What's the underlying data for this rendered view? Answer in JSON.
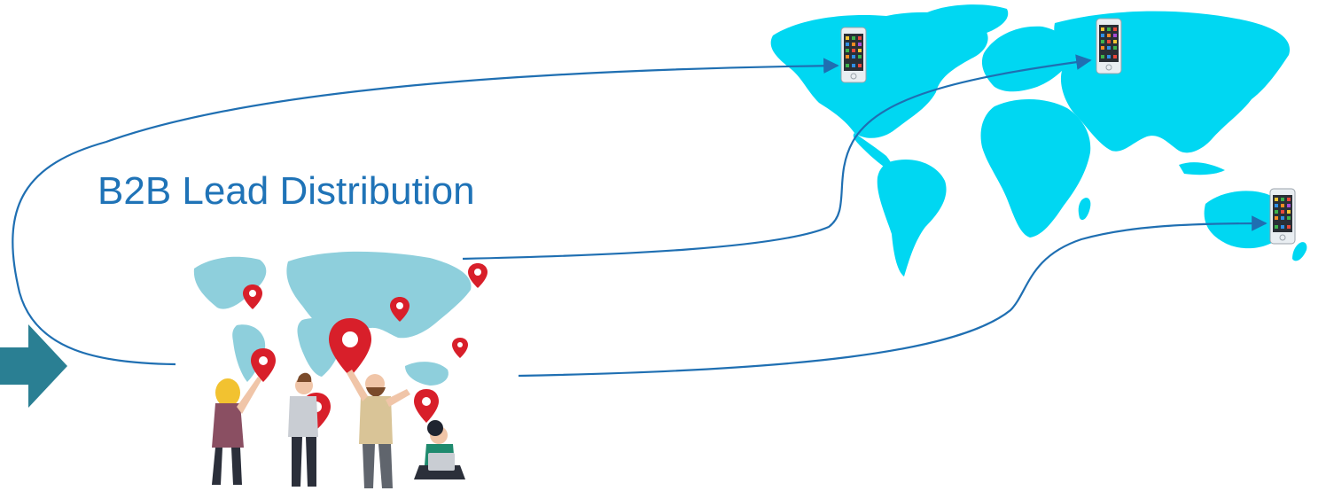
{
  "title": "B2B Lead Distribution",
  "colors": {
    "title": "#1f73b7",
    "connector": "#1f6fb2",
    "world_map": "#00d7f2",
    "pin_map": "#8ecfdc",
    "pin": "#d81f2a",
    "entry_arrow": "#2a7f93",
    "phone_body": "#e9eef2"
  },
  "icons": {
    "entry": "arrow-right-icon",
    "device": "smartphone-icon",
    "marker": "map-pin-icon"
  },
  "flows": [
    {
      "id": "flow-north-america",
      "target": "phone-north-america"
    },
    {
      "id": "flow-europe",
      "target": "phone-europe"
    },
    {
      "id": "flow-australia",
      "target": "phone-australia"
    }
  ]
}
